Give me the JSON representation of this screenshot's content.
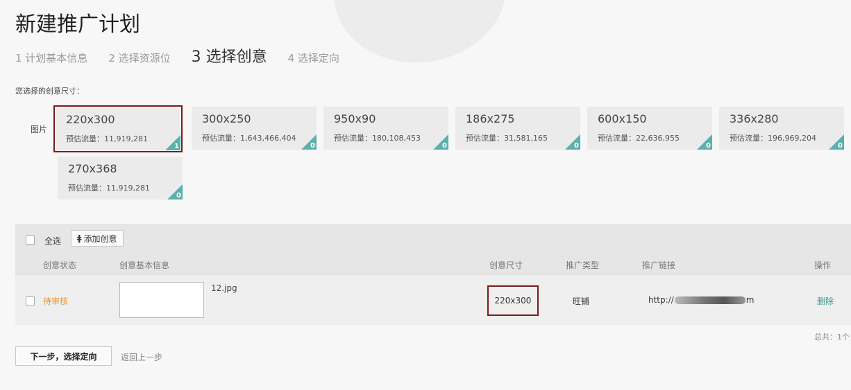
{
  "title": "新建推广计划",
  "steps": [
    {
      "label": "1 计划基本信息",
      "active": false
    },
    {
      "label": "2 选择资源位",
      "active": false
    },
    {
      "label": "3 选择创意",
      "active": true
    },
    {
      "label": "4 选择定向",
      "active": false
    }
  ],
  "size_section_label": "您选择的创意尺寸：",
  "image_row_label": "图片",
  "sizes": [
    {
      "size": "220x300",
      "flow": "预估流量：11,919,281",
      "count": "1",
      "selected": true
    },
    {
      "size": "300x250",
      "flow": "预估流量：1,643,466,404",
      "count": "0",
      "selected": false
    },
    {
      "size": "950x90",
      "flow": "预估流量：180,108,453",
      "count": "0",
      "selected": false
    },
    {
      "size": "186x275",
      "flow": "预估流量：31,581,165",
      "count": "0",
      "selected": false
    },
    {
      "size": "600x150",
      "flow": "预估流量：22,636,955",
      "count": "0",
      "selected": false
    },
    {
      "size": "336x280",
      "flow": "预估流量：196,969,204",
      "count": "0",
      "selected": false
    },
    {
      "size": "270x368",
      "flow": "预估流量：11,919,281",
      "count": "0",
      "selected": false
    }
  ],
  "table": {
    "select_all": "全选",
    "add_button": "添加创意",
    "headers": {
      "status": "创意状态",
      "info": "创意基本信息",
      "size": "创意尺寸",
      "type": "推广类型",
      "link": "推广链接",
      "action": "操作"
    },
    "rows": [
      {
        "status": "待审核",
        "filename": "12.jpg",
        "size": "220x300",
        "type": "旺铺",
        "link_prefix": "http://",
        "link_suffix": "m",
        "action": "删除"
      }
    ]
  },
  "total": "总共：1个",
  "next_button": "下一步，选择定向",
  "back_link": "返回上一步",
  "colors": {
    "accent_teal": "#5bb0ab",
    "selected_border": "#7a1a1a",
    "status_pending": "#e8962b"
  }
}
